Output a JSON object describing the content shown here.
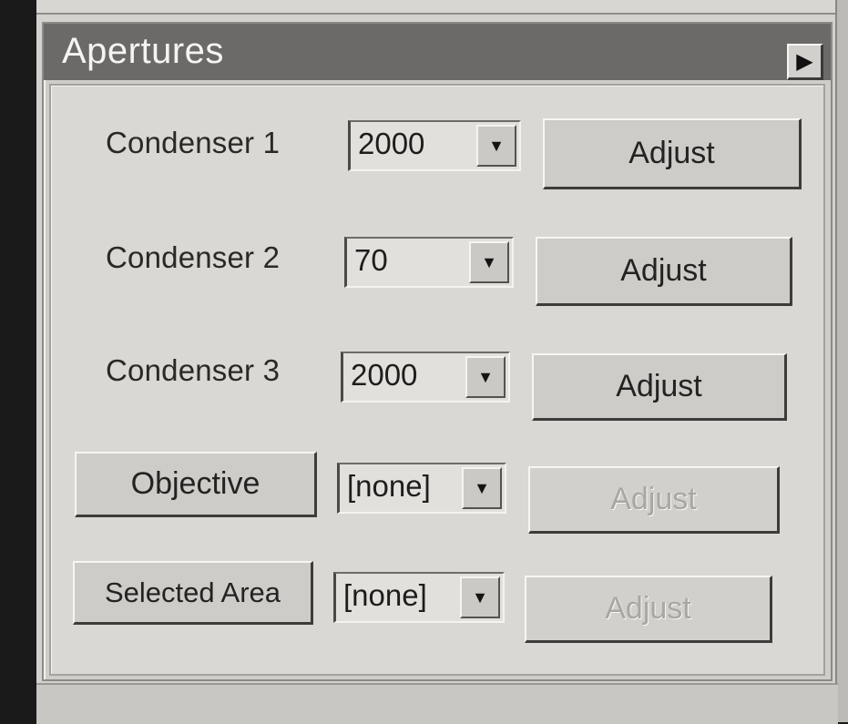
{
  "panel": {
    "title": "Apertures",
    "expand_icon": "triangle-right-icon"
  },
  "rows": [
    {
      "label": "Condenser 1",
      "value": "2000",
      "adjust_label": "Adjust",
      "adjust_enabled": true
    },
    {
      "label": "Condenser 2",
      "value": "70",
      "adjust_label": "Adjust",
      "adjust_enabled": true
    },
    {
      "label": "Condenser 3",
      "value": "2000",
      "adjust_label": "Adjust",
      "adjust_enabled": true
    },
    {
      "label": "Objective",
      "value": "[none]",
      "adjust_label": "Adjust",
      "adjust_enabled": false
    },
    {
      "label": "Selected Area",
      "value": "[none]",
      "adjust_label": "Adjust",
      "adjust_enabled": false
    }
  ],
  "colors": {
    "titlebar": "#6b6a69",
    "panel_bg": "#dad8d4",
    "disabled_text": "#a9a7a3"
  }
}
